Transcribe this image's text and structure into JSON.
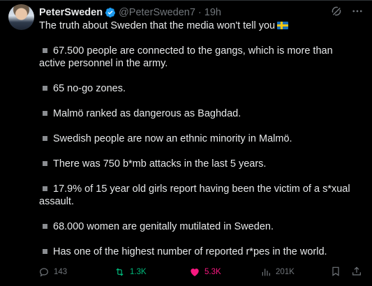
{
  "author": {
    "name": "PeterSweden",
    "handle": "@PeterSweden7",
    "separator": "·",
    "time": "19h"
  },
  "tweet": {
    "intro": "The truth about Sweden that the media won't tell you",
    "flag_icon": "sweden-flag",
    "items": [
      "67.500 people are connected to the gangs, which is more than active personnel in the army.",
      "65 no-go zones.",
      "Malmö ranked as dangerous as Baghdad.",
      "Swedish people are now an ethnic minority in Malmö.",
      "There was 750 b*mb attacks in the last 5 years.",
      "17.9% of 15 year old girls report having been the victim of a s*xual assault.",
      "68.000 women are genitally mutilated in Sweden.",
      "Has one of the highest number of reported r*pes in the world."
    ]
  },
  "actions": {
    "replies": "143",
    "reposts": "1.3K",
    "likes": "5.3K",
    "views": "201K"
  },
  "colors": {
    "background": "#000000",
    "text": "#e7e9ea",
    "muted": "#71767b",
    "repost": "#00ba7c",
    "like": "#f91880",
    "verified": "#1d9bf0"
  }
}
